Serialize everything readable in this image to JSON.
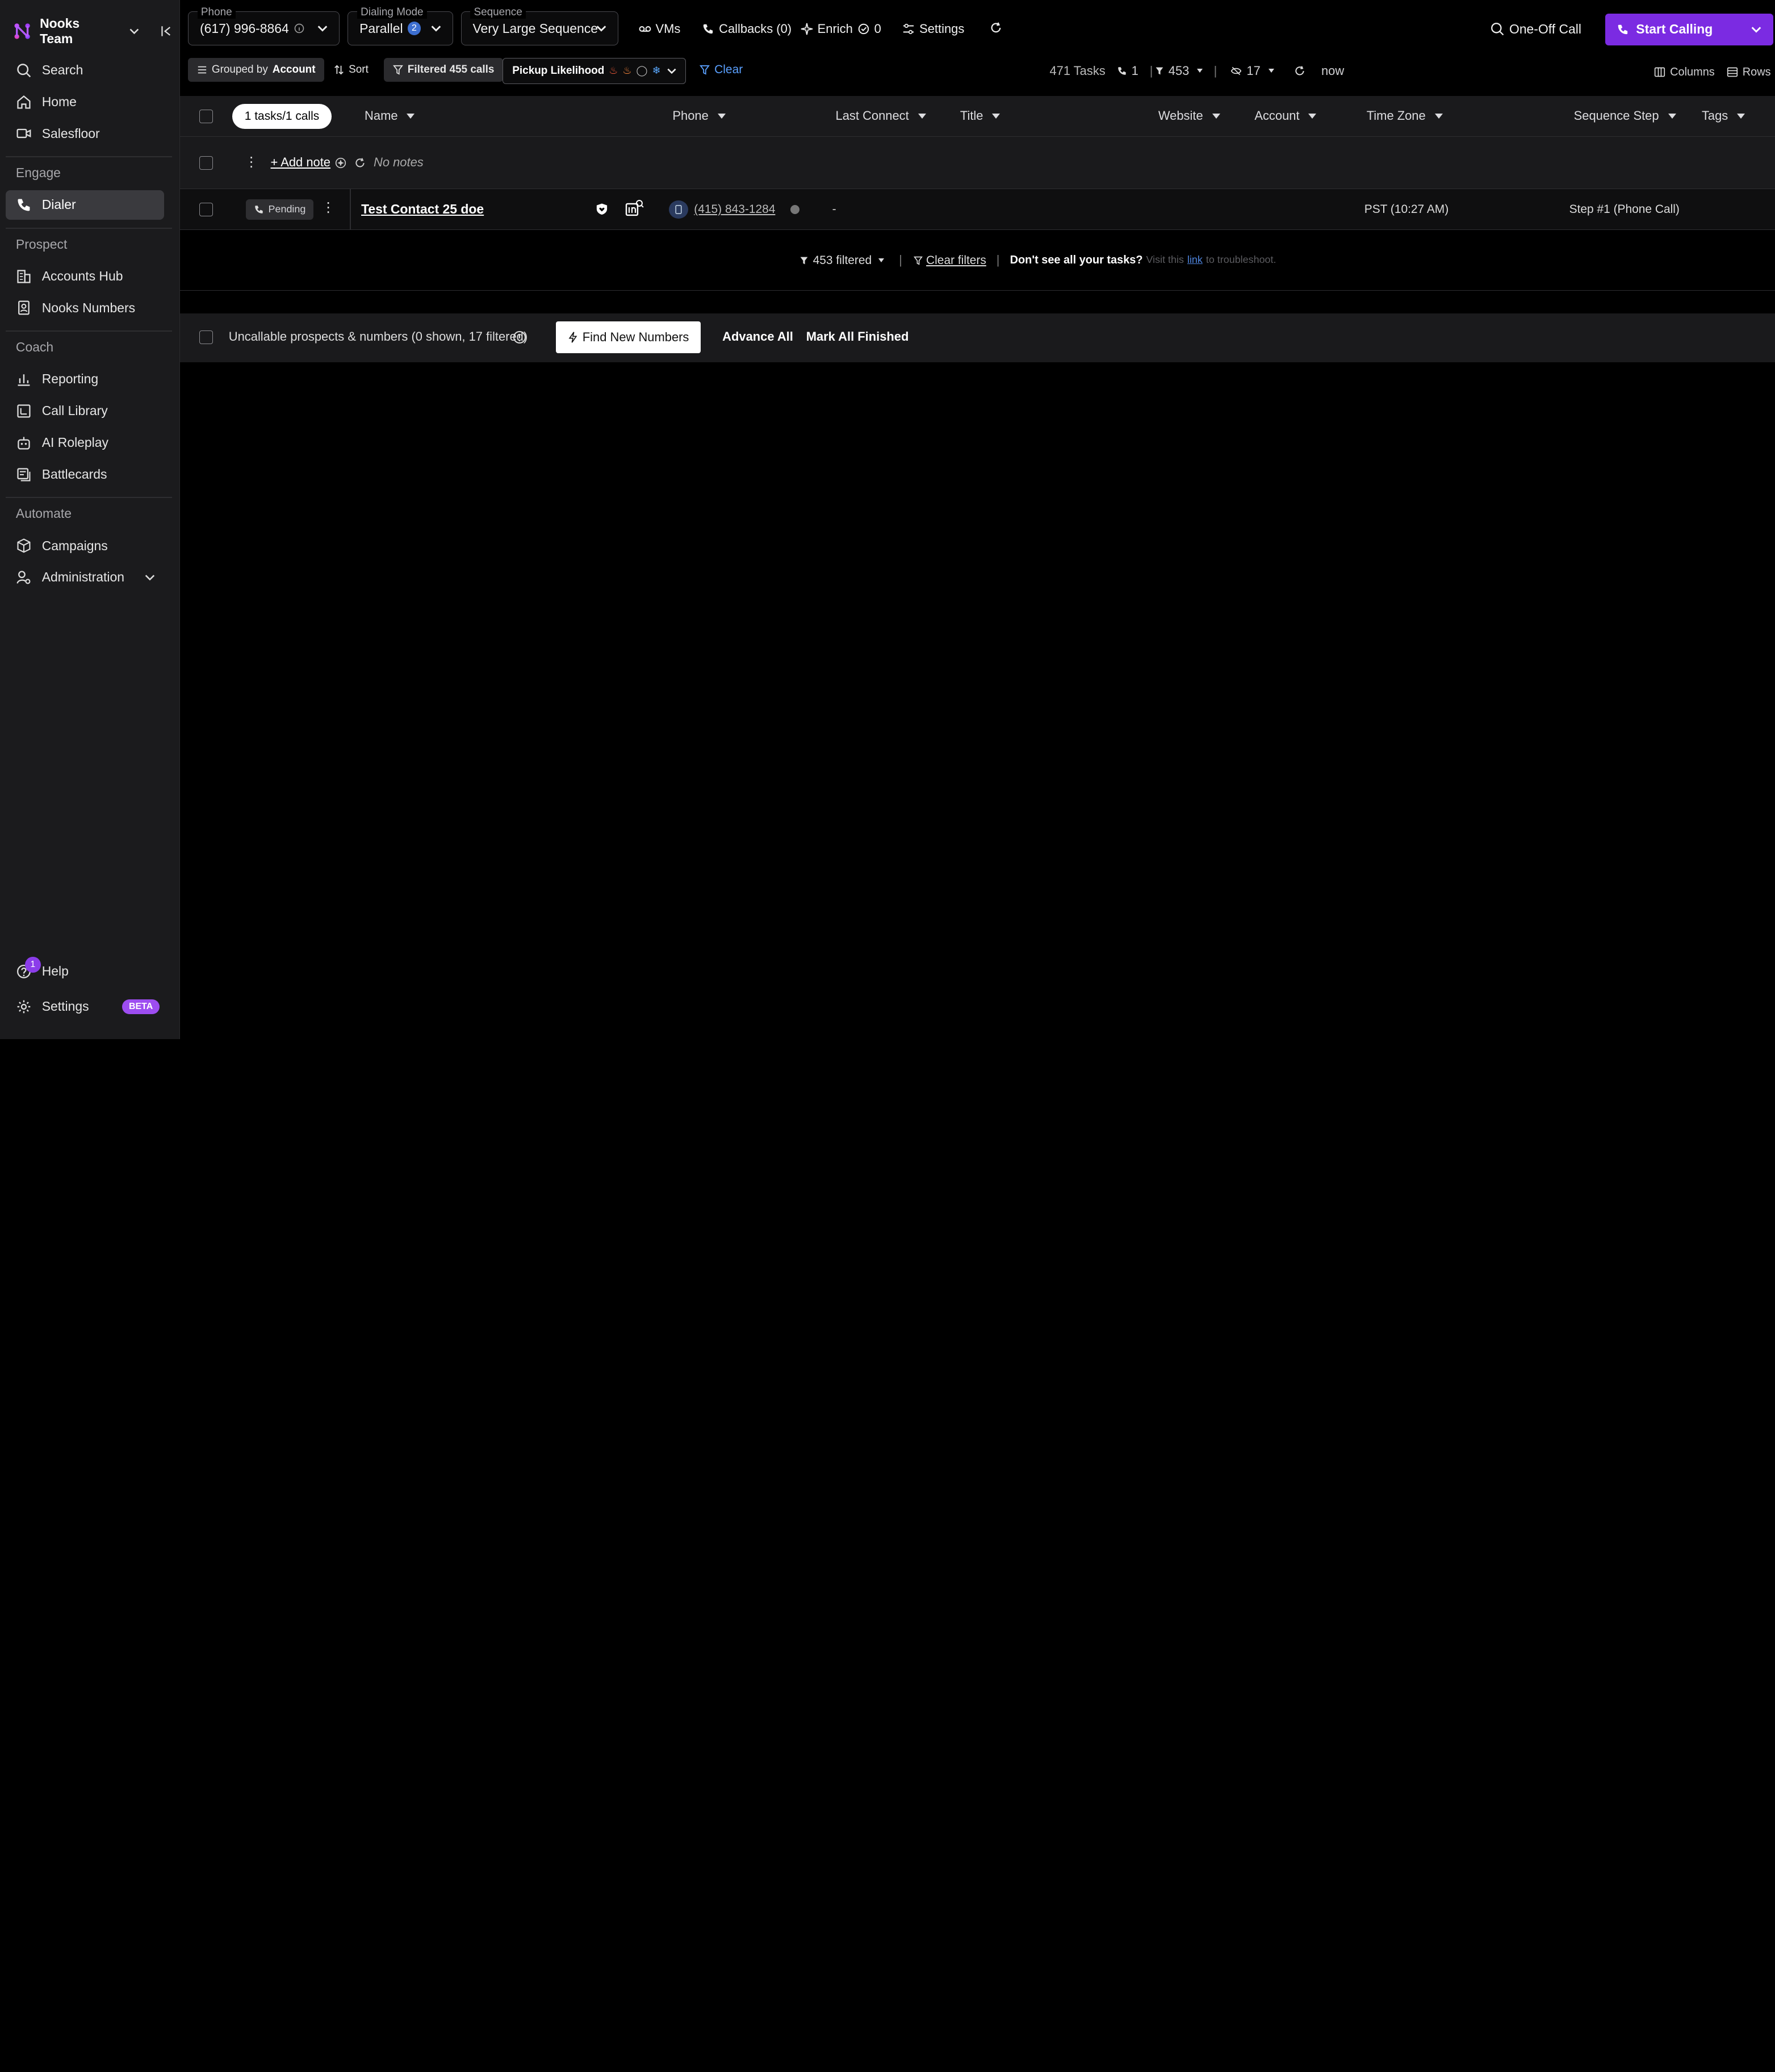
{
  "sidebar": {
    "team_name": "Nooks Team",
    "items_top": [
      {
        "label": "Search",
        "icon": "search-icon"
      },
      {
        "label": "Home",
        "icon": "home-icon"
      },
      {
        "label": "Salesfloor",
        "icon": "video-icon"
      }
    ],
    "sections": {
      "engage": "Engage",
      "prospect": "Prospect",
      "coach": "Coach",
      "automate": "Automate"
    },
    "dialer": "Dialer",
    "accounts_hub": "Accounts Hub",
    "nooks_numbers": "Nooks Numbers",
    "reporting": "Reporting",
    "call_library": "Call Library",
    "ai_roleplay": "AI Roleplay",
    "battlecards": "Battlecards",
    "campaigns": "Campaigns",
    "administration": "Administration",
    "help": "Help",
    "help_badge": "1",
    "settings": "Settings",
    "beta": "BETA"
  },
  "topbar": {
    "phone_label": "Phone",
    "phone_value": "(617) 996-8864",
    "dialing_label": "Dialing Mode",
    "dialing_value": "Parallel",
    "dialing_count": "2",
    "sequence_label": "Sequence",
    "sequence_value": "Very Large Sequence",
    "vms": "VMs",
    "callbacks": "Callbacks (0)",
    "enrich": "Enrich",
    "enrich_count": "0",
    "settings": "Settings",
    "one_off_call": "One-Off Call",
    "start_calling": "Start Calling"
  },
  "filterbar": {
    "grouped_prefix": "Grouped by",
    "grouped_value": "Account",
    "sort": "Sort",
    "filtered": "Filtered 455 calls",
    "pickup": "Pickup Likelihood",
    "clear": "Clear",
    "tasks": "471 Tasks",
    "calls_count": "1",
    "filtered_count": "453",
    "hidden_count": "17",
    "refresh": "now",
    "columns": "Columns",
    "rows": "Rows"
  },
  "table": {
    "tasks_pill": "1 tasks/1 calls",
    "headers": {
      "name": "Name",
      "phone": "Phone",
      "last_connect": "Last Connect",
      "title": "Title",
      "website": "Website",
      "account": "Account",
      "time_zone": "Time Zone",
      "sequence_step": "Sequence Step",
      "tags": "Tags"
    },
    "note_row": {
      "add_note": "+ Add note",
      "no_notes": "No notes"
    },
    "contact_row": {
      "status": "Pending",
      "name": "Test Contact 25 doe",
      "phone": "(415) 843-1284",
      "last_connect": "-",
      "time_zone": "PST (10:27 AM)",
      "sequence_step": "Step #1 (Phone Call)"
    },
    "footer": {
      "filtered": "453 filtered",
      "clear_filters": "Clear filters",
      "dont_see": "Don't see all your tasks?",
      "visit": "Visit this",
      "link": "link",
      "troubleshoot": "to troubleshoot."
    },
    "uncallable": {
      "label": "Uncallable prospects & numbers (0 shown, 17 filtered)",
      "find_numbers": "Find New Numbers",
      "advance_all": "Advance All",
      "mark_finished": "Mark All Finished"
    }
  }
}
